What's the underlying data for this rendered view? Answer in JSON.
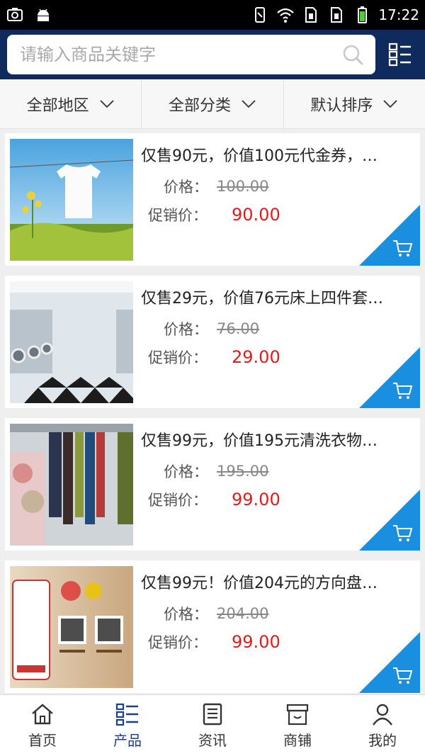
{
  "status_bar": {
    "time": "17:22"
  },
  "search": {
    "placeholder": "请输入商品关键字"
  },
  "filters": [
    {
      "label": "全部地区"
    },
    {
      "label": "全部分类"
    },
    {
      "label": "默认排序"
    }
  ],
  "products": [
    {
      "title": "仅售90元，价值100元代金券，…",
      "price_label": "价格：",
      "original_price": "100.00",
      "promo_label": "促销价：",
      "promo_price": "90.00"
    },
    {
      "title": "仅售29元，价值76元床上四件套…",
      "price_label": "价格：",
      "original_price": "76.00",
      "promo_label": "促销价：",
      "promo_price": "29.00"
    },
    {
      "title": "仅售99元，价值195元清洗衣物…",
      "price_label": "价格：",
      "original_price": "195.00",
      "promo_label": "促销价：",
      "promo_price": "99.00"
    },
    {
      "title": "仅售99元！价值204元的方向盘…",
      "price_label": "价格：",
      "original_price": "204.00",
      "promo_label": "促销价：",
      "promo_price": "99.00"
    }
  ],
  "nav": [
    {
      "label": "首页",
      "icon": "home-icon"
    },
    {
      "label": "产品",
      "icon": "product-list-icon",
      "active": true
    },
    {
      "label": "资讯",
      "icon": "news-icon"
    },
    {
      "label": "商铺",
      "icon": "shop-icon"
    },
    {
      "label": "我的",
      "icon": "user-icon"
    }
  ],
  "colors": {
    "header_bg": "#0f2a5c",
    "accent_blue": "#1a8fe0",
    "promo_red": "#e31b1b",
    "nav_active": "#1a3f8f"
  }
}
